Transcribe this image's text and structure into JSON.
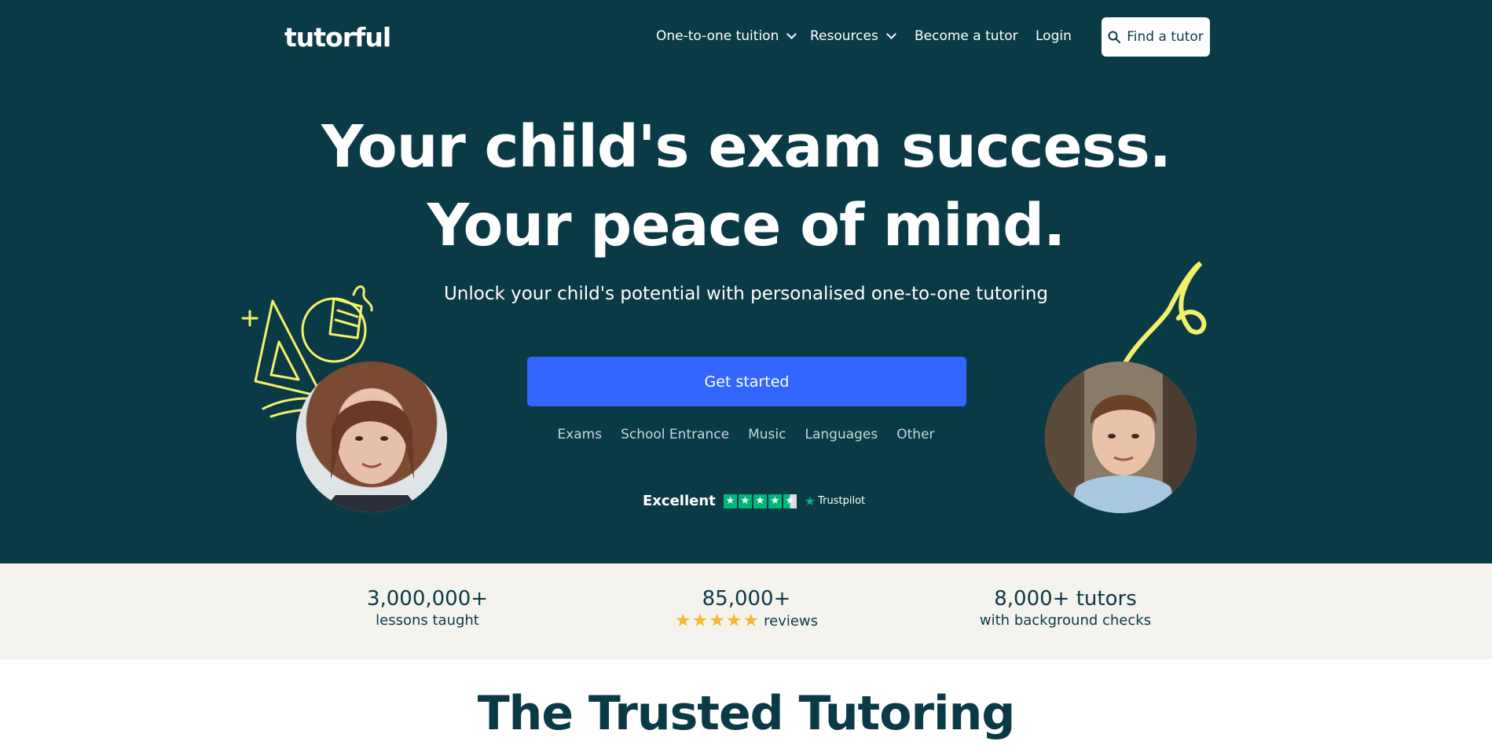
{
  "brand": {
    "logo": "tutorful"
  },
  "nav": {
    "items": [
      {
        "label": "One-to-one tuition",
        "has_dropdown": true
      },
      {
        "label": "Resources",
        "has_dropdown": true
      },
      {
        "label": "Become a tutor",
        "has_dropdown": false
      },
      {
        "label": "Login",
        "has_dropdown": false
      }
    ],
    "find_tutor": {
      "label": "Find a tutor",
      "icon": "search-icon"
    }
  },
  "hero": {
    "headline_line1": "Your child's exam success.",
    "headline_line2": "Your peace of mind.",
    "subheadline": "Unlock your child's potential with personalised one-to-one tutoring",
    "cta_label": "Get started",
    "categories": [
      "Exams",
      "School Entrance",
      "Music",
      "Languages",
      "Other"
    ],
    "trustpilot": {
      "label": "Excellent",
      "brand": "Trustpilot",
      "rating_stars": 4.5
    }
  },
  "stats": [
    {
      "value": "3,000,000+",
      "label": "lessons taught"
    },
    {
      "value": "85,000+",
      "label": "reviews",
      "stars": 5
    },
    {
      "value": "8,000+ tutors",
      "label": "with background checks"
    }
  ],
  "section": {
    "title": "The Trusted Tutoring"
  },
  "colors": {
    "hero_bg": "#0b3a47",
    "cta": "#3366ff",
    "doodle": "#f3f06a",
    "trustpilot_green": "#00b67a",
    "stats_bg": "#f5f3ee",
    "star_gold": "#f5b82e"
  }
}
